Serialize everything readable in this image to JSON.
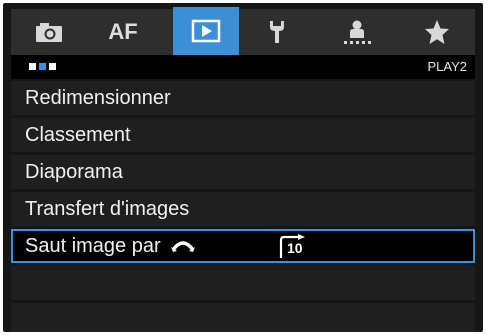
{
  "tabs": [
    {
      "name": "shooting",
      "icon": "camera-icon",
      "label": ""
    },
    {
      "name": "af",
      "icon": "",
      "label": "AF"
    },
    {
      "name": "playback",
      "icon": "playback-icon",
      "label": "",
      "active": true
    },
    {
      "name": "setup",
      "icon": "wrench-icon",
      "label": ""
    },
    {
      "name": "custom-functions",
      "icon": "custom-functions-icon",
      "label": ""
    },
    {
      "name": "my-menu",
      "icon": "star-icon",
      "label": ""
    }
  ],
  "subbar": {
    "page_label": "PLAY2",
    "page_dots": 3,
    "active_dot": 2
  },
  "menu": {
    "items": [
      {
        "label": "Redimensionner"
      },
      {
        "label": "Classement"
      },
      {
        "label": "Diaporama"
      },
      {
        "label": "Transfert d'images"
      },
      {
        "label": "Saut image par",
        "value_icon": "jump-10-images-icon",
        "selected": true
      }
    ],
    "value_text": "10"
  },
  "colors": {
    "accent": "#3b8fd6",
    "background": "#161616",
    "item_background": "#1f1f1f",
    "text": "#f0f0f0"
  }
}
